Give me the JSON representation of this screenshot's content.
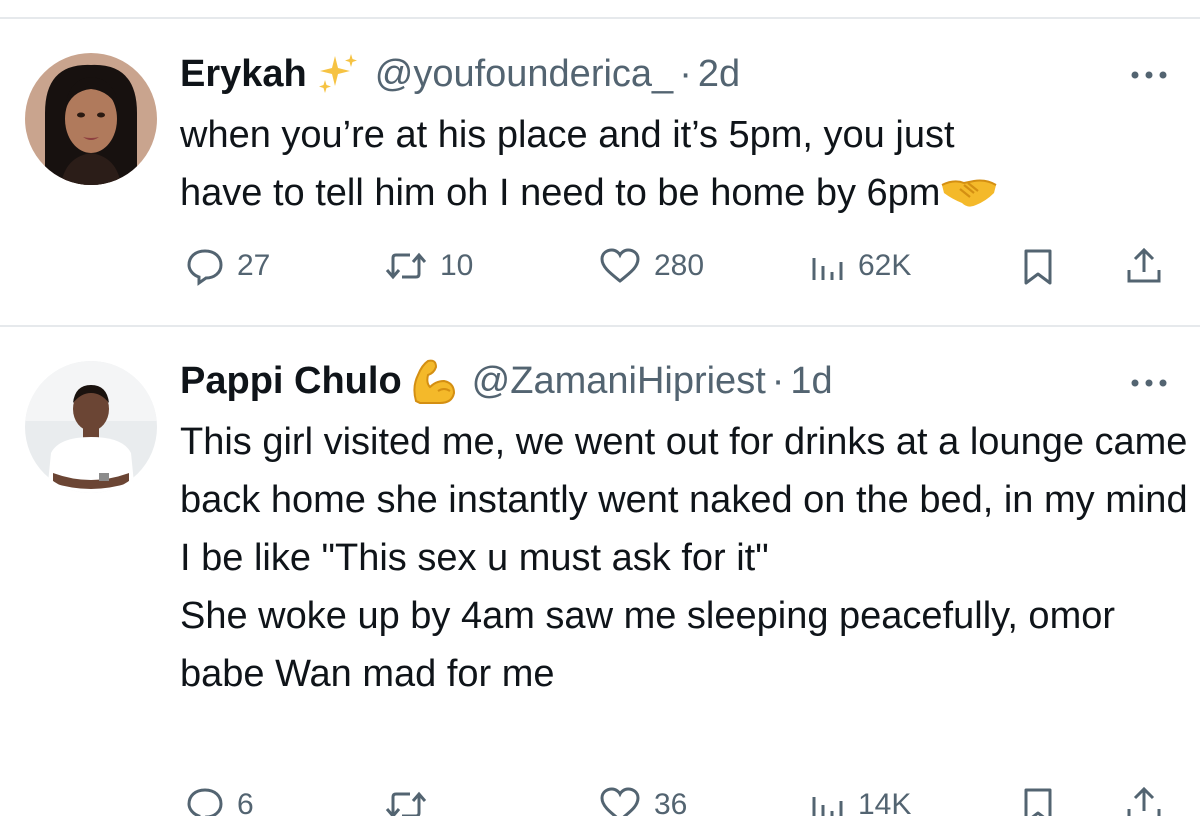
{
  "tweets": [
    {
      "author": "Erykah",
      "name_emoji": "sparkles-emoji",
      "handle": "@youfounderica_",
      "separator": "·",
      "time": "2d",
      "text_lines": [
        "when you’re at his place and it’s 5pm, you just",
        "have to tell him oh I need to be home by 6pm"
      ],
      "text_emoji": "handshake-emoji",
      "replies": "27",
      "reposts": "10",
      "likes": "280",
      "views": "62K"
    },
    {
      "author": "Pappi Chulo",
      "name_emoji": "flexed-biceps-emoji",
      "handle": "@ZamaniHipriest",
      "separator": "·",
      "time": "1d",
      "paragraphs": [
        "This girl visited me, we went out for drinks at a lounge came back home she instantly went naked on the bed, in my mind I be like \"This sex u must ask for it\"",
        "She woke up by 4am saw me sleeping peacefully, omor babe Wan mad for me"
      ],
      "replies": "6",
      "reposts": "",
      "likes": "36",
      "views": "14K"
    }
  ],
  "colors": {
    "text": "#0f1419",
    "secondary": "#536471",
    "divider": "#e6e9ec",
    "emoji_yellow": "#f4b92a"
  },
  "icons": [
    "reply-icon",
    "repost-icon",
    "like-icon",
    "views-icon",
    "bookmark-icon",
    "share-icon",
    "more-icon"
  ]
}
